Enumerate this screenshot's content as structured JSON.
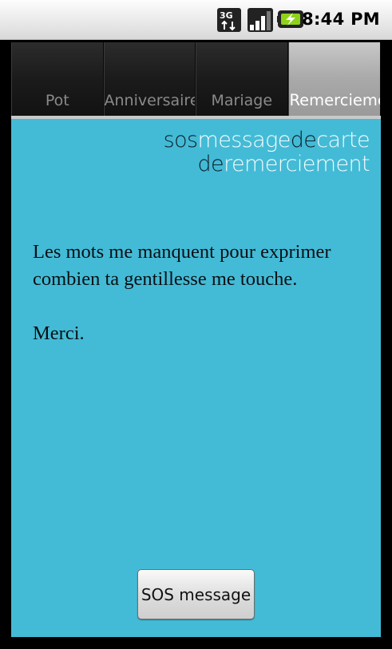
{
  "status_bar": {
    "network_icon": "3g-data-icon",
    "signal_icon": "signal-strength-icon",
    "battery_icon": "battery-charging-icon",
    "time": "8:44 PM"
  },
  "tabs": [
    {
      "label": "Pot",
      "selected": false
    },
    {
      "label": "Anniversaire",
      "selected": false
    },
    {
      "label": "Mariage",
      "selected": false
    },
    {
      "label": "Remerciement",
      "selected": true
    }
  ],
  "logo": {
    "line1": [
      {
        "text": "sos",
        "tone": "dark"
      },
      {
        "text": "message",
        "tone": "light"
      },
      {
        "text": "de",
        "tone": "dark"
      },
      {
        "text": "carte",
        "tone": "light"
      }
    ],
    "line2": [
      {
        "text": "de",
        "tone": "dark"
      },
      {
        "text": "remerciement",
        "tone": "light"
      }
    ]
  },
  "message": {
    "text": "Les mots me manquent pour exprimer\ncombien ta gentillesse me touche.\n\nMerci."
  },
  "button": {
    "label": "SOS message"
  },
  "colors": {
    "panel_background": "#43bbd6",
    "logo_dark": "#0f1f2b",
    "logo_light": "#f4fbfd",
    "selected_tab": "#a9a9a9",
    "unselected_tab": "#1b1b1b"
  }
}
